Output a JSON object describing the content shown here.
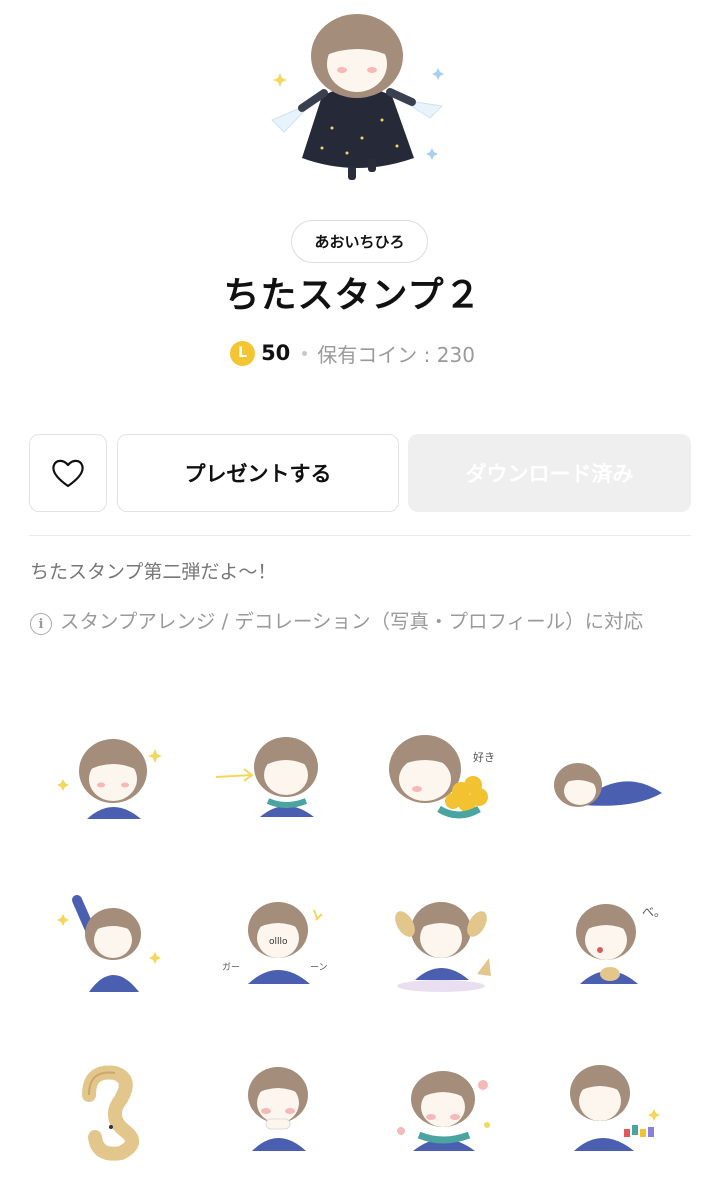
{
  "header": {
    "author": "あおいちひろ",
    "title": "ちたスタンプ２",
    "coin_letter": "L",
    "price": "50",
    "balance": "保有コイン : 230"
  },
  "actions": {
    "favorite_icon": "heart-icon",
    "gift_label": "プレゼントする",
    "download_label": "ダウンロード済み"
  },
  "description": "ちたスタンプ第二弾だよ〜！",
  "note": {
    "icon": "info-icon",
    "text": "スタンプアレンジ / デコレーション（写真・プロフィール）に対応"
  },
  "stamps": [
    {
      "name": "sparkle",
      "text": ""
    },
    {
      "name": "arrow",
      "text": ""
    },
    {
      "name": "flowers",
      "text": "好き"
    },
    {
      "name": "lying-down",
      "text": ""
    },
    {
      "name": "jump",
      "text": ""
    },
    {
      "name": "nose-glasses",
      "text": "ガーーン"
    },
    {
      "name": "dog-ears",
      "text": ""
    },
    {
      "name": "tongue",
      "text": "べ。"
    },
    {
      "name": "curl",
      "text": ""
    },
    {
      "name": "shy",
      "text": ""
    },
    {
      "name": "blossom",
      "text": ""
    },
    {
      "name": "bouquet",
      "text": ""
    }
  ],
  "colors": {
    "accent_coin": "#f5c432",
    "hair": "#a48d7a",
    "coat": "#4a5fb0",
    "scarf": "#4aa5a0"
  }
}
